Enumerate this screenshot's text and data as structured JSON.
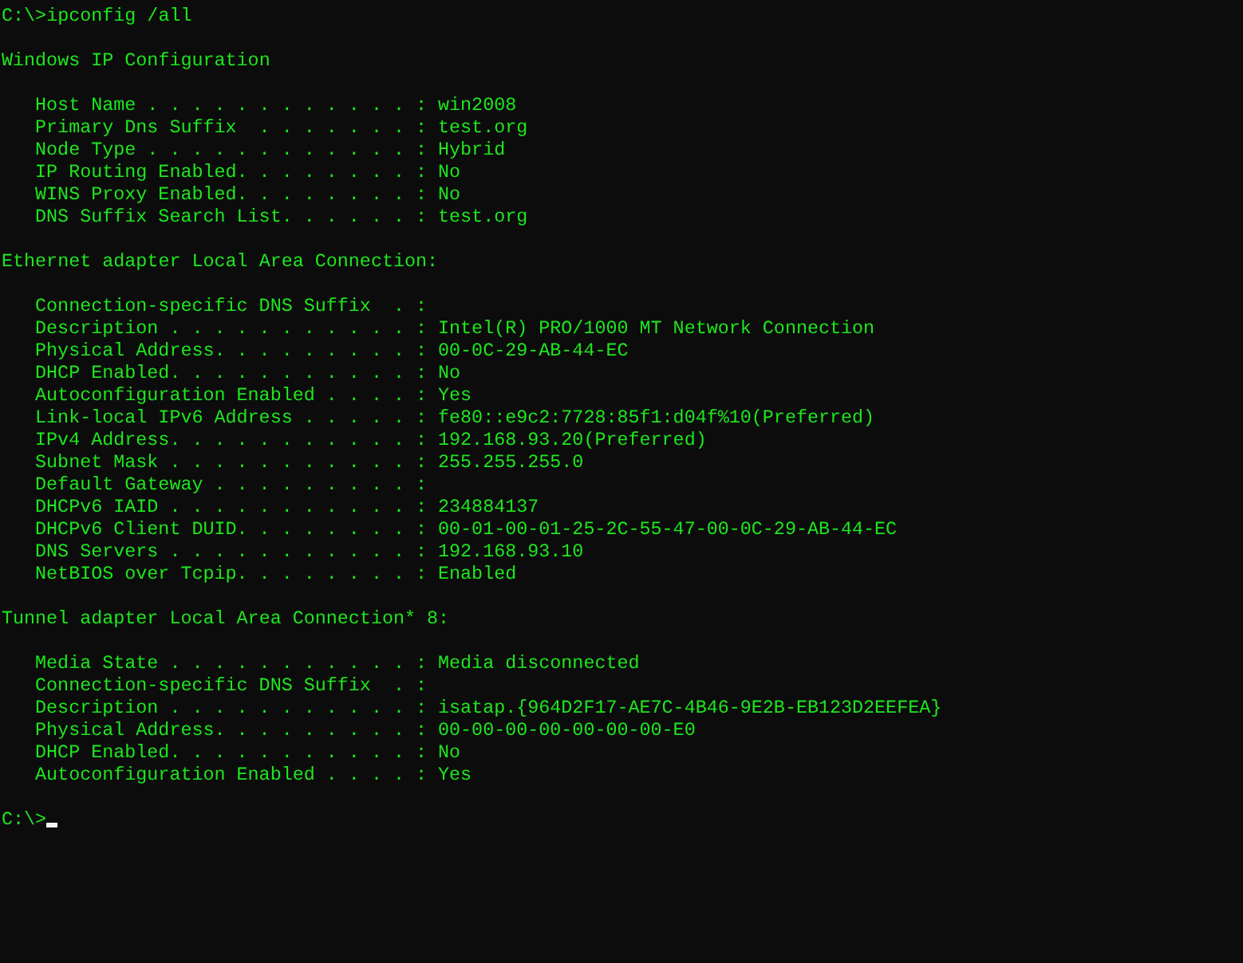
{
  "command": {
    "prompt": "C:\\>",
    "text": "ipconfig /all"
  },
  "sections": [
    {
      "heading": "Windows IP Configuration",
      "entries": [
        {
          "label": "Host Name . . . . . . . . . . . . :",
          "value": "win2008"
        },
        {
          "label": "Primary Dns Suffix  . . . . . . . :",
          "value": "test.org"
        },
        {
          "label": "Node Type . . . . . . . . . . . . :",
          "value": "Hybrid"
        },
        {
          "label": "IP Routing Enabled. . . . . . . . :",
          "value": "No"
        },
        {
          "label": "WINS Proxy Enabled. . . . . . . . :",
          "value": "No"
        },
        {
          "label": "DNS Suffix Search List. . . . . . :",
          "value": "test.org"
        }
      ]
    },
    {
      "heading": "Ethernet adapter Local Area Connection:",
      "entries": [
        {
          "label": "Connection-specific DNS Suffix  . :"
        },
        {
          "label": "Description . . . . . . . . . . . :",
          "value": "Intel(R) PRO/1000 MT Network Connection"
        },
        {
          "label": "Physical Address. . . . . . . . . :",
          "value": "00-0C-29-AB-44-EC"
        },
        {
          "label": "DHCP Enabled. . . . . . . . . . . :",
          "value": "No"
        },
        {
          "label": "Autoconfiguration Enabled . . . . :",
          "value": "Yes"
        },
        {
          "label": "Link-local IPv6 Address . . . . . :",
          "value": "fe80::e9c2:7728:85f1:d04f%10(Preferred)"
        },
        {
          "label": "IPv4 Address. . . . . . . . . . . :",
          "value": "192.168.93.20(Preferred)"
        },
        {
          "label": "Subnet Mask . . . . . . . . . . . :",
          "value": "255.255.255.0"
        },
        {
          "label": "Default Gateway . . . . . . . . . :"
        },
        {
          "label": "DHCPv6 IAID . . . . . . . . . . . :",
          "value": "234884137"
        },
        {
          "label": "DHCPv6 Client DUID. . . . . . . . :",
          "value": "00-01-00-01-25-2C-55-47-00-0C-29-AB-44-EC"
        },
        {
          "label": "DNS Servers . . . . . . . . . . . :",
          "value": "192.168.93.10"
        },
        {
          "label": "NetBIOS over Tcpip. . . . . . . . :",
          "value": "Enabled"
        }
      ]
    },
    {
      "heading": "Tunnel adapter Local Area Connection* 8:",
      "entries": [
        {
          "label": "Media State . . . . . . . . . . . :",
          "value": "Media disconnected"
        },
        {
          "label": "Connection-specific DNS Suffix  . :"
        },
        {
          "label": "Description . . . . . . . . . . . :",
          "value": "isatap.{964D2F17-AE7C-4B46-9E2B-EB123D2EEFEA}"
        },
        {
          "label": "Physical Address. . . . . . . . . :",
          "value": "00-00-00-00-00-00-00-E0"
        },
        {
          "label": "DHCP Enabled. . . . . . . . . . . :",
          "value": "No"
        },
        {
          "label": "Autoconfiguration Enabled . . . . :",
          "value": "Yes"
        }
      ]
    }
  ],
  "final_prompt": {
    "prompt": "C:\\>",
    "cursor": true
  }
}
